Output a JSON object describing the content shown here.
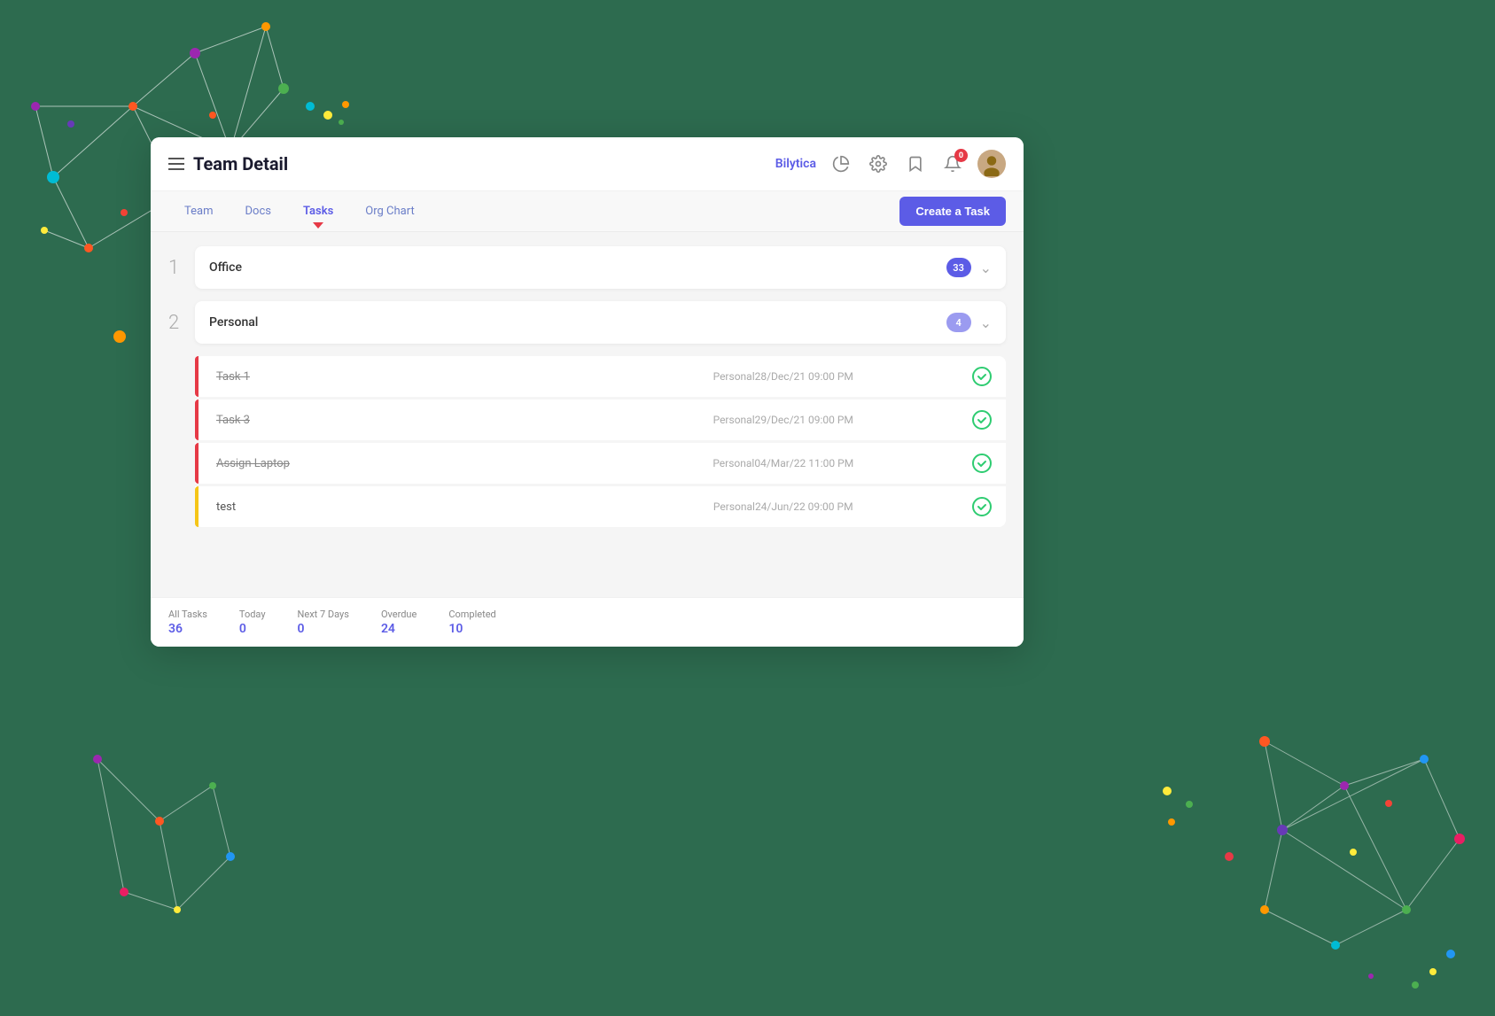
{
  "page": {
    "title": "Team Detail",
    "brand": "Bilytica"
  },
  "header": {
    "hamburger_label": "menu",
    "brand": "Bilytica",
    "notification_count": "0",
    "icons": [
      "pie-chart-icon",
      "settings-icon",
      "bookmark-icon",
      "notification-icon",
      "avatar-icon"
    ]
  },
  "nav": {
    "tabs": [
      {
        "label": "Team",
        "active": false
      },
      {
        "label": "Docs",
        "active": false
      },
      {
        "label": "Tasks",
        "active": true
      },
      {
        "label": "Org Chart",
        "active": false
      }
    ],
    "create_button": "Create a Task"
  },
  "groups": [
    {
      "number": "1",
      "name": "Office",
      "badge": "33",
      "expanded": false,
      "tasks": []
    },
    {
      "number": "2",
      "name": "Personal",
      "badge": "4",
      "expanded": true,
      "tasks": [
        {
          "name": "Task 1",
          "date": "Personal28/Dec/21 09:00 PM",
          "completed": true,
          "strikethrough": true,
          "bar_color": "red"
        },
        {
          "name": "Task 3",
          "date": "Personal29/Dec/21 09:00 PM",
          "completed": true,
          "strikethrough": true,
          "bar_color": "red"
        },
        {
          "name": "Assign Laptop",
          "date": "Personal04/Mar/22 11:00 PM",
          "completed": true,
          "strikethrough": true,
          "bar_color": "red"
        },
        {
          "name": "test",
          "date": "Personal24/Jun/22 09:00 PM",
          "completed": true,
          "strikethrough": false,
          "bar_color": "yellow"
        }
      ]
    }
  ],
  "footer": {
    "stats": [
      {
        "label": "All Tasks",
        "value": "36"
      },
      {
        "label": "Today",
        "value": "0"
      },
      {
        "label": "Next 7 Days",
        "value": "0"
      },
      {
        "label": "Overdue",
        "value": "24"
      },
      {
        "label": "Completed",
        "value": "10"
      }
    ]
  }
}
